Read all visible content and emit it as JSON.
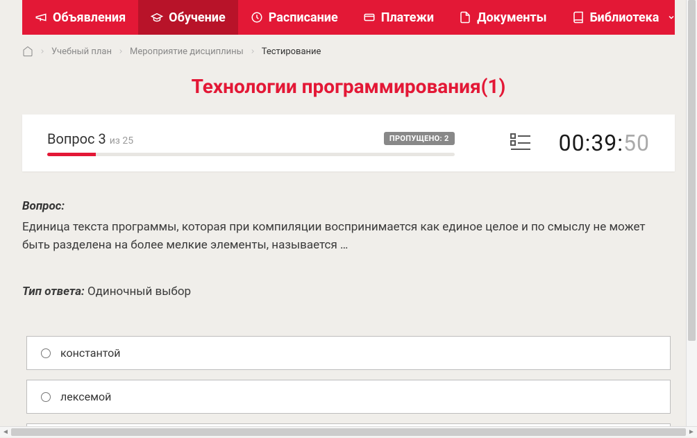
{
  "nav": {
    "items": [
      {
        "label": "Объявления",
        "icon": "megaphone"
      },
      {
        "label": "Обучение",
        "icon": "graduation",
        "active": true
      },
      {
        "label": "Расписание",
        "icon": "clock"
      },
      {
        "label": "Платежи",
        "icon": "payment"
      },
      {
        "label": "Документы",
        "icon": "document"
      },
      {
        "label": "Библиотека",
        "icon": "book",
        "dropdown": true
      }
    ]
  },
  "breadcrumb": {
    "items": [
      {
        "label": "Учебный план"
      },
      {
        "label": "Мероприятие дисциплины"
      }
    ],
    "current": "Тестирование"
  },
  "page_title": "Технологии программирования(1)",
  "quiz": {
    "question_label_prefix": "Вопрос",
    "question_number": "3",
    "question_total_prefix": "из",
    "question_total": "25",
    "skipped_label": "ПРОПУЩЕНО: 2",
    "progress_percent": 12,
    "timer_main": "00:39:",
    "timer_sec": "50"
  },
  "question": {
    "heading": "Вопрос:",
    "text": "Единица текста программы, которая при компиляции воспринимается как единое целое и по смыслу не может быть разделена на более мелкие элементы, называется …",
    "answer_type_label": "Тип ответа:",
    "answer_type_value": "Одиночный выбор",
    "options": [
      {
        "label": "константой"
      },
      {
        "label": "лексемой"
      }
    ]
  }
}
